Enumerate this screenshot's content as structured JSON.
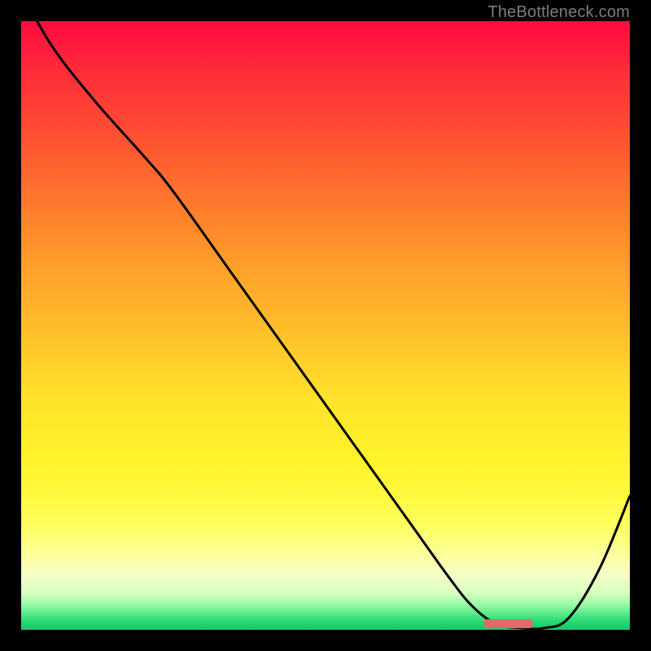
{
  "watermark": "TheBottleneck.com",
  "chart_data": {
    "type": "line",
    "title": "",
    "xlabel": "",
    "ylabel": "",
    "xlim": [
      0,
      100
    ],
    "ylim": [
      0,
      100
    ],
    "x": [
      0,
      5,
      12,
      20,
      25,
      35,
      45,
      55,
      65,
      70,
      74,
      78,
      82,
      86,
      90,
      95,
      100
    ],
    "values": [
      105,
      96,
      87,
      78,
      72,
      58,
      44,
      30,
      16,
      9,
      4,
      1,
      0.3,
      0.3,
      2,
      10,
      22
    ],
    "marker": {
      "x": 80,
      "y": 0.5,
      "width": 8,
      "color": "#e06a6a"
    },
    "gradient_stops": [
      {
        "pos": 0.0,
        "color": "#ff0a3f"
      },
      {
        "pos": 0.5,
        "color": "#ffc229"
      },
      {
        "pos": 0.85,
        "color": "#feff61"
      },
      {
        "pos": 1.0,
        "color": "#12c867"
      }
    ]
  }
}
